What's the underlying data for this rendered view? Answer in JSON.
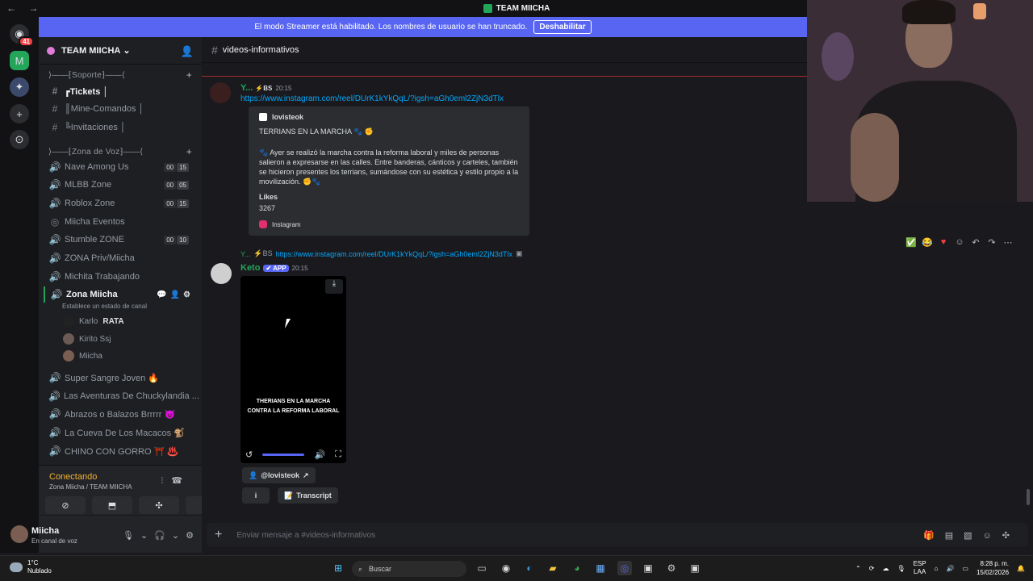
{
  "window": {
    "title": "TEAM MIICHA",
    "nav": "← →"
  },
  "banner": {
    "text": "El modo Streamer está habilitado. Los nombres de usuario se han truncado.",
    "button": "Deshabilitar"
  },
  "guilds": {
    "badge": "41"
  },
  "server": {
    "name": "TEAM MIICHA"
  },
  "channels": {
    "cat_soporte": "⟩——⁅Soporte⁆——⟨",
    "tickets": "┏Tickets │",
    "mine": "║Mine-Comandos │",
    "invitaciones": "╚Invitaciones │",
    "cat_voz": "⟩——⁅Zona de Voz⁆——⟨",
    "voice": [
      {
        "name": "Nave Among Us",
        "a": "00",
        "b": "15"
      },
      {
        "name": "MLBB Zone",
        "a": "00",
        "b": "05"
      },
      {
        "name": "Roblox Zone",
        "a": "00",
        "b": "15"
      },
      {
        "name": "Miicha Eventos"
      },
      {
        "name": "Stumble ZONE",
        "a": "00",
        "b": "10"
      },
      {
        "name": "ZONA Priv/Miicha"
      },
      {
        "name": "Michita Trabajando"
      }
    ],
    "zona": {
      "name": "Zona Miicha",
      "status": "Establece un estado de canal"
    },
    "members": [
      {
        "name": "Karlo",
        "tag": "RATA"
      },
      {
        "name": "Kirito Ssj"
      },
      {
        "name": "Miicha"
      }
    ],
    "more": [
      {
        "name": "Super Sangre Joven 🔥"
      },
      {
        "name": "Las Aventuras De Chuckylandia ..."
      },
      {
        "name": "Abrazos o Balazos Brrrrr 😈"
      },
      {
        "name": "La Cueva De Los Macacos 🐒"
      },
      {
        "name": "CHINO CON GORRO ⛩️ ♨️"
      }
    ]
  },
  "voice_panel": {
    "status": "Conectando",
    "sub": "Zona Miicha / TEAM MIICHA"
  },
  "user": {
    "name": "Miicha",
    "status": "En canal de voz"
  },
  "chat": {
    "channel": "videos-informativos",
    "msg1": {
      "user": "Y...",
      "tag": "⚡BS",
      "time": "20:15",
      "link": "https://www.instagram.com/reel/DUrK1kYkQqL/?igsh=aGh0eml2ZjN3dTlx",
      "embed": {
        "author": "lovisteok",
        "title": "TERRIANS EN LA MARCHA 🐾 ✊",
        "desc": "🐾 Ayer se realizó la marcha contra la reforma laboral y miles de personas salieron a expresarse en las calles. Entre banderas, cánticos y carteles, también se hicieron presentes los terrians, sumándose con su estética y estilo propio a la movilización. ✊🐾",
        "label": "Likes",
        "value": "3267",
        "footer": "Instagram"
      }
    },
    "msg2": {
      "reply_user": "Y...",
      "reply_tag": "⚡BS",
      "reply_link": "https://www.instagram.com/reel/DUrK1kYkQqL/?igsh=aGh0eml2ZjN3dTlx",
      "user": "Keto",
      "app": "✔ APP",
      "time": "20:15",
      "caption1": "THERIANS EN LA MARCHA",
      "caption2": "CONTRA LA REFORMA LABORAL",
      "chip_user": "@lovisteok",
      "chip_info": "i",
      "chip_transcript": "Transcript"
    },
    "composer_placeholder": "Enviar mensaje a #videos-informativos"
  },
  "taskbar": {
    "weather_temp": "1°C",
    "weather_desc": "Nublado",
    "search": "Buscar",
    "lang1": "ESP",
    "lang2": "LAA",
    "time": "8:28 p. m.",
    "date": "15/02/2026"
  }
}
